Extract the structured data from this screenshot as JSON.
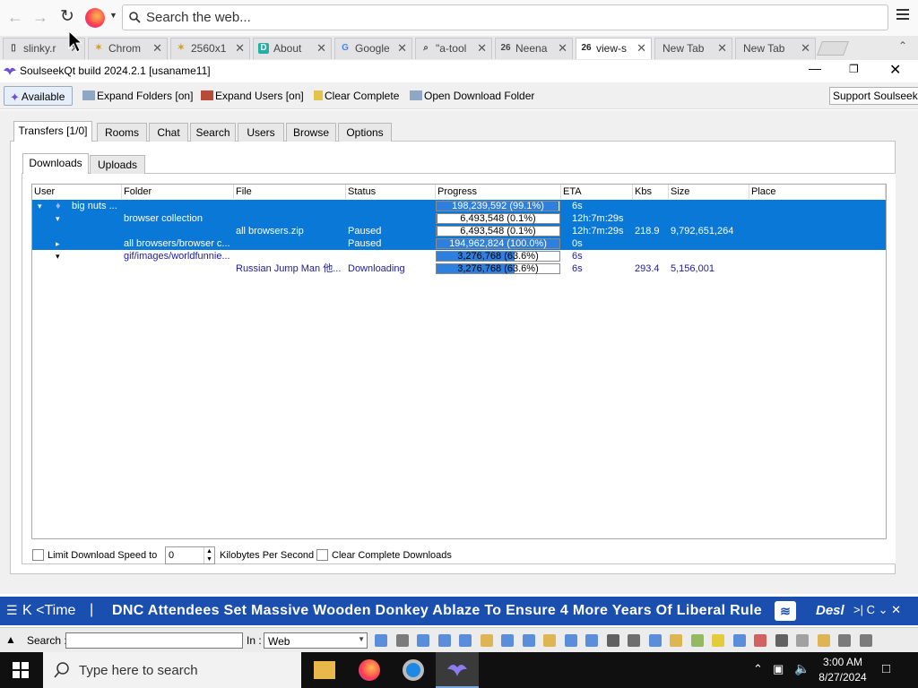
{
  "browser": {
    "search_placeholder": "Search the web...",
    "tabs": [
      {
        "label": "slinky.r",
        "fav": "doc-icon"
      },
      {
        "label": "Chrom",
        "fav": "puzzle-icon"
      },
      {
        "label": "2560x1",
        "fav": "puzzle-icon"
      },
      {
        "label": "About",
        "fav": "d-icon"
      },
      {
        "label": "Google",
        "fav": "google-icon"
      },
      {
        "label": "\"a-tool",
        "fav": "search-icon"
      },
      {
        "label": "Neena",
        "fav": "26-icon"
      },
      {
        "label": "view-s",
        "fav": "26-icon"
      },
      {
        "label": "New Tab",
        "fav": ""
      },
      {
        "label": "New Tab",
        "fav": ""
      }
    ]
  },
  "app": {
    "title": "SoulseekQt build 2024.2.1 [usaname11]",
    "toolbar": {
      "available": "Available",
      "expand_folders": "Expand Folders [on]",
      "expand_users": "Expand Users [on]",
      "clear_complete": "Clear Complete",
      "open_download_folder": "Open Download Folder",
      "support": "Support Soulseek!"
    },
    "main_tabs": [
      "Transfers [1/0]",
      "Rooms",
      "Chat",
      "Search",
      "Users",
      "Browse",
      "Options"
    ],
    "sub_tabs": [
      "Downloads",
      "Uploads"
    ],
    "columns": [
      "User",
      "Folder",
      "File",
      "Status",
      "Progress",
      "ETA",
      "Kbs",
      "Size",
      "Place"
    ],
    "rows": [
      {
        "user": "big nuts ...",
        "folder": "",
        "file": "",
        "status": "",
        "progress_text": "198,239,592 (99.1%)",
        "progress": 0.991,
        "eta": "6s",
        "kbs": "",
        "size": "",
        "selected": true
      },
      {
        "user": "",
        "folder": "browser collection",
        "file": "",
        "status": "",
        "progress_text": "6,493,548 (0.1%)",
        "progress": 0.001,
        "eta": "12h:7m:29s",
        "kbs": "",
        "size": "",
        "selected": true
      },
      {
        "user": "",
        "folder": "",
        "file": "all browsers.zip",
        "status": "Paused",
        "progress_text": "6,493,548 (0.1%)",
        "progress": 0.001,
        "eta": "12h:7m:29s",
        "kbs": "218.9",
        "size": "9,792,651,264",
        "selected": true
      },
      {
        "user": "",
        "folder": "all browsers/browser c...",
        "file": "",
        "status": "Paused",
        "progress_text": "194,962,824 (100.0%)",
        "progress": 1.0,
        "eta": "0s",
        "kbs": "",
        "size": "",
        "selected": true
      },
      {
        "user": "",
        "folder": "gif/images/worldfunnie...",
        "file": "",
        "status": "",
        "progress_text": "3,276,768 (63.6%)",
        "progress": 0.636,
        "eta": "6s",
        "kbs": "",
        "size": "",
        "selected": false
      },
      {
        "user": "",
        "folder": "",
        "file": "Russian Jump Man 他...",
        "status": "Downloading",
        "progress_text": "3,276,768 (63.6%)",
        "progress": 0.636,
        "eta": "6s",
        "kbs": "293.4",
        "size": "5,156,001",
        "selected": false
      }
    ],
    "bottom": {
      "limit_label": "Limit Download Speed to",
      "speed_value": "0",
      "unit_label": "Kilobytes Per Second",
      "clear_label": "Clear Complete Downloads"
    }
  },
  "ticker": {
    "time_label": "K <Time",
    "headline": "DNC Attendees Set Massive Wooden Donkey Ablaze To Ensure 4 More Years Of Liberal Rule",
    "right_label": "Desl"
  },
  "toolbar2": {
    "search_label": "Search :",
    "in_label": "In :",
    "in_value": "Web"
  },
  "taskbar": {
    "search_placeholder": "Type here to search",
    "time": "3:00 AM",
    "date": "8/27/2024"
  },
  "colors": {
    "selection": "#0a78d7",
    "ticker_bg": "#1a4fb0",
    "folder_text": "#1a1aa8"
  }
}
